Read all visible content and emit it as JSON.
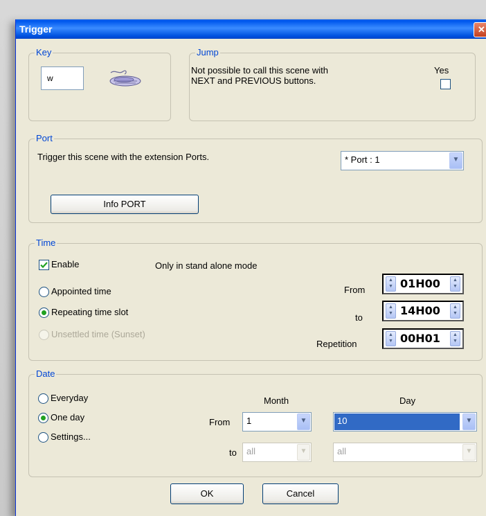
{
  "window": {
    "title": "Trigger",
    "close_label": "✕"
  },
  "key": {
    "legend": "Key",
    "value": "w",
    "icon": "keyboard-icon"
  },
  "jump": {
    "legend": "Jump",
    "text_line1": "Not possible to call this scene with",
    "text_line2": "NEXT and PREVIOUS buttons.",
    "yes_label": "Yes",
    "checked": false
  },
  "port": {
    "legend": "Port",
    "description": "Trigger this scene with the extension Ports.",
    "selected": "* Port : 1",
    "info_button": "Info PORT"
  },
  "time": {
    "legend": "Time",
    "enable_label": "Enable",
    "enable_checked": true,
    "standalone_note": "Only in stand alone mode",
    "options": [
      {
        "label": "Appointed time",
        "selected": false,
        "disabled": false
      },
      {
        "label": "Repeating time slot",
        "selected": true,
        "disabled": false
      },
      {
        "label": "Unsettled time (Sunset)",
        "selected": false,
        "disabled": true
      }
    ],
    "from_label": "From",
    "from_value": "01H00",
    "to_label": "to",
    "to_value": "14H00",
    "repetition_label": "Repetition",
    "repetition_value": "00H01"
  },
  "date": {
    "legend": "Date",
    "options": [
      {
        "label": "Everyday",
        "selected": false
      },
      {
        "label": "One day",
        "selected": true
      },
      {
        "label": "Settings...",
        "selected": false
      }
    ],
    "month_header": "Month",
    "day_header": "Day",
    "from_label": "From",
    "to_label": "to",
    "from_month": "1",
    "from_day": "10",
    "to_month": "all",
    "to_day": "all"
  },
  "buttons": {
    "ok": "OK",
    "cancel": "Cancel"
  },
  "colors": {
    "titlebar": "#0058EE",
    "legend": "#0046D5",
    "selection": "#316AC5"
  }
}
